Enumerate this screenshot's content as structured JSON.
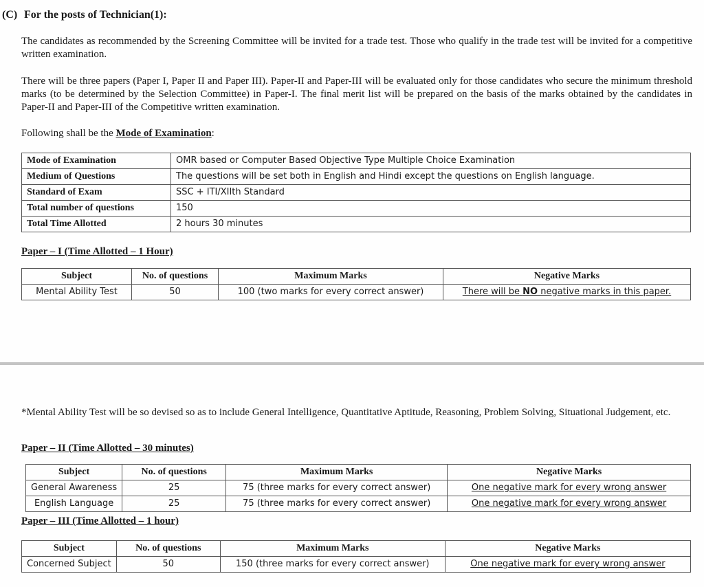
{
  "heading": {
    "number": "(C)",
    "title": "For the posts of Technician(1):"
  },
  "paragraphs": {
    "p1": "The candidates as recommended by the Screening Committee will be invited for a trade test.  Those who qualify in the trade test will be invited for a competitive written examination.",
    "p2": "There will be three papers (Paper I, Paper II and Paper III).  Paper-II and Paper-III will be evaluated only for those candidates who secure the minimum threshold marks (to be determined by the Selection Committee) in Paper-I.  The final merit list will be prepared on the basis of the marks obtained by the candidates in Paper-II and Paper-III of the Competitive written examination.",
    "p3_prefix": "Following shall be the ",
    "p3_link": "Mode of Examination",
    "p3_suffix": ":"
  },
  "mode_table": {
    "rows": [
      {
        "key": "Mode of Examination",
        "value": "OMR based or Computer Based Objective Type Multiple Choice Examination"
      },
      {
        "key": "Medium of Questions",
        "value": "The questions will be set both in English and Hindi except the questions on English language."
      },
      {
        "key": "Standard of Exam",
        "value": "SSC + ITI/XIIth Standard"
      },
      {
        "key": "Total number of questions",
        "value": "150"
      },
      {
        "key": "Total Time Allotted",
        "value": "2 hours 30 minutes"
      }
    ]
  },
  "paper1": {
    "title": "Paper – I (Time Allotted – 1 Hour)",
    "headers": [
      "Subject",
      "No. of questions",
      "Maximum Marks",
      "Negative Marks"
    ],
    "rows": [
      {
        "subject": "Mental Ability Test",
        "questions": "50",
        "max_marks": "100 (two marks for every correct answer)",
        "neg_prefix": "There will be ",
        "neg_bold": "NO",
        "neg_suffix": " negative marks in this paper."
      }
    ]
  },
  "note": "*Mental Ability Test will be so devised so as to include General Intelligence, Quantitative Aptitude, Reasoning, Problem Solving, Situational Judgement, etc.",
  "paper2": {
    "title": "Paper – II (Time Allotted – 30 minutes)",
    "headers": [
      "Subject",
      "No. of questions",
      "Maximum Marks",
      "Negative Marks"
    ],
    "rows": [
      {
        "subject": "General Awareness",
        "questions": "25",
        "max_marks": "75 (three marks for every correct answer)",
        "negative": "One negative mark for every wrong answer"
      },
      {
        "subject": "English Language",
        "questions": "25",
        "max_marks": "75 (three marks for every correct answer)",
        "negative": "One negative mark for every wrong answer"
      }
    ]
  },
  "paper3": {
    "title": "Paper – III (Time Allotted – 1 hour)",
    "headers": [
      "Subject",
      "No. of questions",
      "Maximum Marks",
      "Negative Marks"
    ],
    "rows": [
      {
        "subject": "Concerned Subject",
        "questions": "50",
        "max_marks": "150 (three marks for every correct answer)",
        "negative": "One negative mark for every wrong answer"
      }
    ]
  }
}
